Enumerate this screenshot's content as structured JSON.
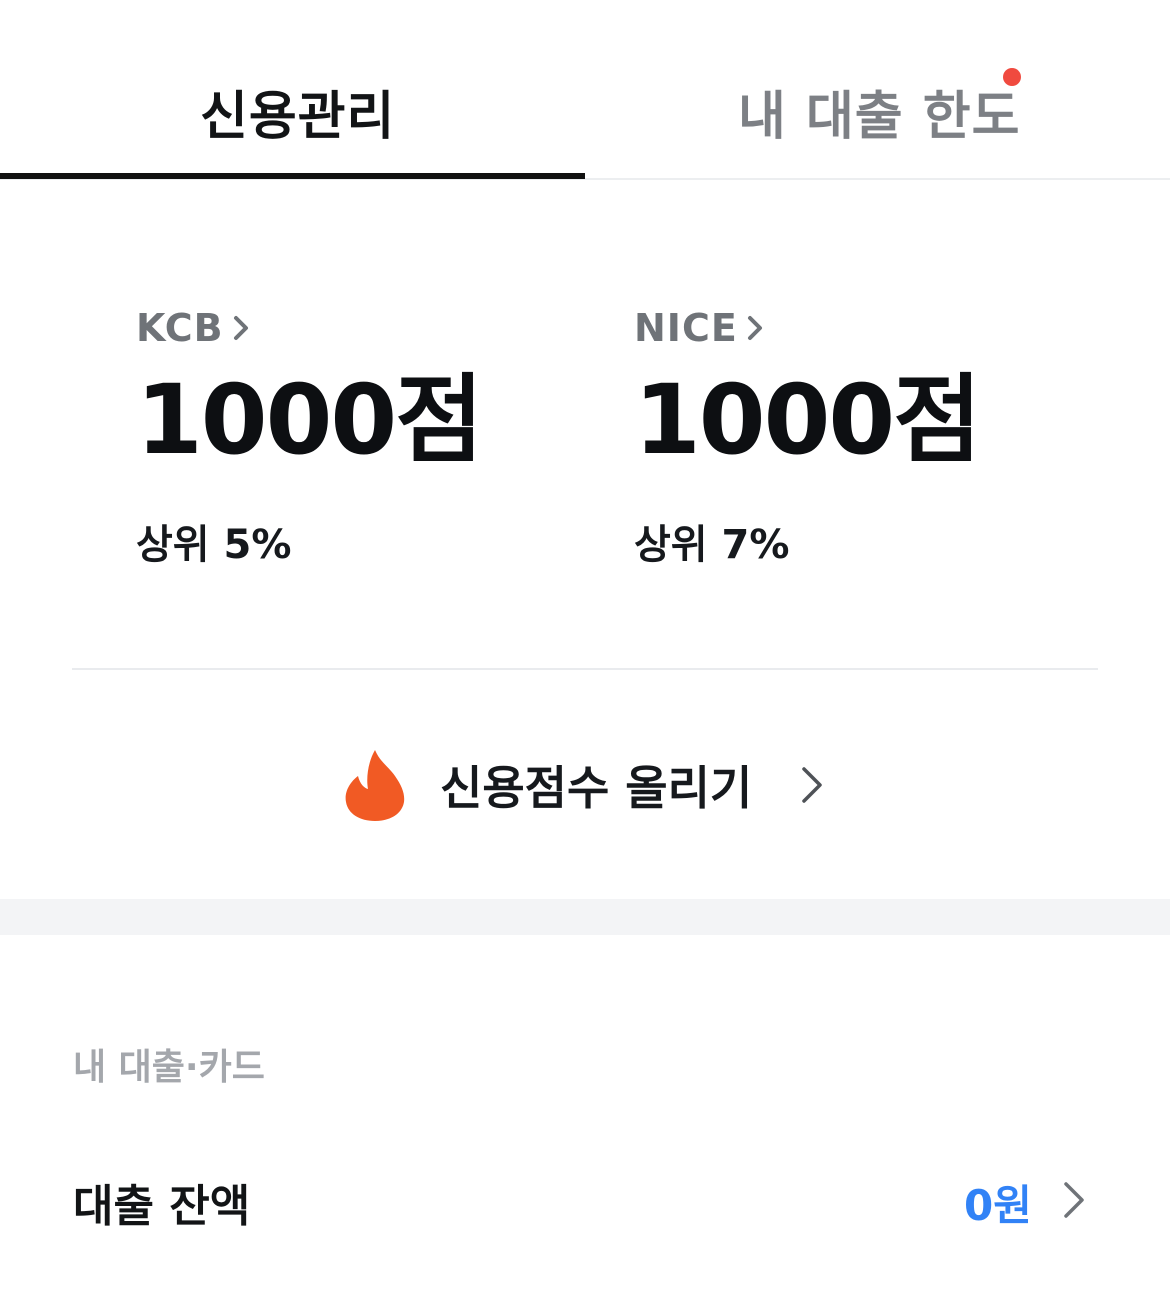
{
  "tabs": [
    {
      "label": "신용관리",
      "active": true
    },
    {
      "label": "내 대출 한도",
      "active": false,
      "has_notification_dot": true
    }
  ],
  "scores": [
    {
      "bureau": "KCB",
      "score": "1000점",
      "rank": "상위 5%"
    },
    {
      "bureau": "NICE",
      "score": "1000점",
      "rank": "상위 7%"
    }
  ],
  "boost": {
    "label": "신용점수 올리기",
    "icon": "fire-icon"
  },
  "loans_section": {
    "title": "내 대출·카드",
    "balance_label": "대출 잔액",
    "balance_value": "0원"
  },
  "colors": {
    "accent_blue": "#3182f6",
    "notification_red": "#f04a3f",
    "fire_orange": "#f15a24"
  }
}
